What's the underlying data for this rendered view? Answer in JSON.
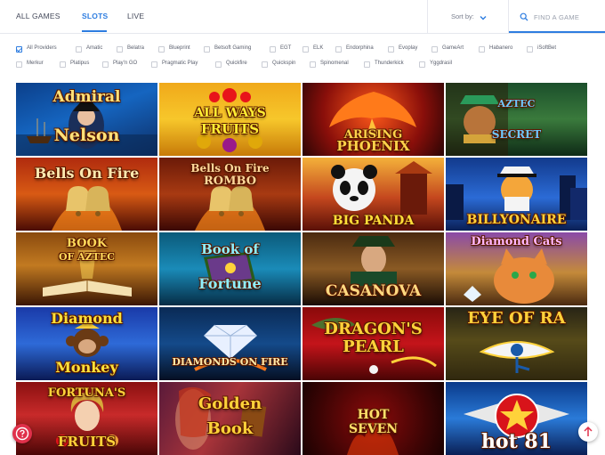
{
  "nav": {
    "tabs": [
      {
        "label": "ALL GAMES"
      },
      {
        "label": "SLOTS"
      },
      {
        "label": "LIVE"
      }
    ],
    "sort_label": "Sort by:",
    "search_placeholder": "FIND A GAME"
  },
  "providers": [
    {
      "label": "All Providers",
      "checked": true
    },
    {
      "label": "Amatic",
      "checked": false
    },
    {
      "label": "Belatra",
      "checked": false
    },
    {
      "label": "Blueprint",
      "checked": false
    },
    {
      "label": "Betsoft Gaming",
      "checked": false
    },
    {
      "label": "EGT",
      "checked": false
    },
    {
      "label": "ELK",
      "checked": false
    },
    {
      "label": "Endorphina",
      "checked": false
    },
    {
      "label": "Evoplay",
      "checked": false
    },
    {
      "label": "GameArt",
      "checked": false
    },
    {
      "label": "Habanero",
      "checked": false
    },
    {
      "label": "iSoftBet",
      "checked": false
    },
    {
      "label": "Merkur",
      "checked": false
    },
    {
      "label": "Platipus",
      "checked": false
    },
    {
      "label": "Play'n GO",
      "checked": false
    },
    {
      "label": "Pragmatic Play",
      "checked": false
    },
    {
      "label": "Quickfire",
      "checked": false
    },
    {
      "label": "Quickspin",
      "checked": false
    },
    {
      "label": "Spinomenal",
      "checked": false
    },
    {
      "label": "Thunderkick",
      "checked": false
    },
    {
      "label": "Yggdrasil",
      "checked": false
    }
  ],
  "games": [
    {
      "title": "Admiral Nelson",
      "line1": "Admiral",
      "line2": "Nelson"
    },
    {
      "title": "All Ways Fruits",
      "line1": "ALL WAYS",
      "line2": "FRUITS"
    },
    {
      "title": "Arising Phoenix",
      "line1": "ARISING",
      "line2": "PHOENIX"
    },
    {
      "title": "Aztec Secret",
      "line1": "AZTEC",
      "line2": "SECRET"
    },
    {
      "title": "Bells On Fire",
      "line1": "Bells On Fire",
      "line2": ""
    },
    {
      "title": "Bells On Fire Rombo",
      "line1": "Bells On Fire",
      "line2": "ROMBO"
    },
    {
      "title": "Big Panda",
      "line1": "BIG PANDA",
      "line2": ""
    },
    {
      "title": "Billyonaire",
      "line1": "BILLYONAIRE",
      "line2": ""
    },
    {
      "title": "Book of Aztec",
      "line1": "BOOK",
      "line2": "OF AZTEC"
    },
    {
      "title": "Book of Fortune",
      "line1": "Book of",
      "line2": "Fortune"
    },
    {
      "title": "Casanova",
      "line1": "CASANOVA",
      "line2": ""
    },
    {
      "title": "Diamond Cats",
      "line1": "Diamond Cats",
      "line2": ""
    },
    {
      "title": "Diamond Monkey",
      "line1": "Diamond",
      "line2": "Monkey"
    },
    {
      "title": "Diamonds on Fire",
      "line1": "DIAMONDS ON FIRE",
      "line2": ""
    },
    {
      "title": "Dragon's Pearl",
      "line1": "DRAGON'S",
      "line2": "PEARL"
    },
    {
      "title": "Eye of Ra",
      "line1": "EYE OF RA",
      "line2": ""
    },
    {
      "title": "Fortuna's Fruits",
      "line1": "FORTUNA'S",
      "line2": "FRUITS"
    },
    {
      "title": "Golden Book",
      "line1": "Golden",
      "line2": "Book"
    },
    {
      "title": "Hot Seven",
      "line1": "HOT",
      "line2": "SEVEN"
    },
    {
      "title": "Hot 81",
      "line1": "hot 81",
      "line2": ""
    }
  ],
  "colors": {
    "accent": "#2e7de0",
    "help_button": "#e0304a"
  },
  "icons": {
    "search": "search-icon",
    "sort": "chevron-down-icon",
    "help": "chat-help-icon",
    "scroll_top": "arrow-up-icon"
  }
}
